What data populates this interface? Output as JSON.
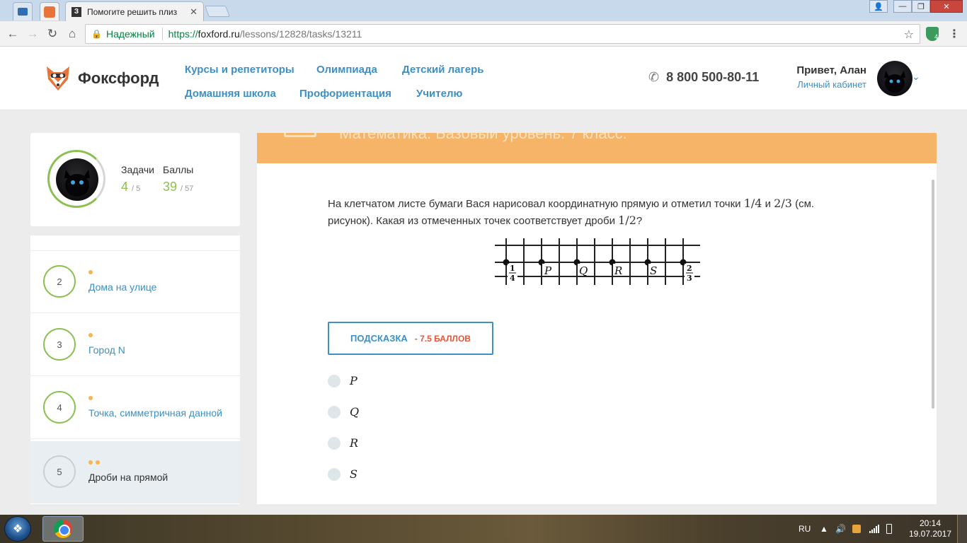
{
  "browser": {
    "tab_title": "Помогите решить плиз",
    "tab_favicon_letter": "З",
    "secure_label": "Надежный",
    "url_scheme": "https://",
    "url_host": "foxford.ru",
    "url_path": "/lessons/12828/tasks/13211",
    "extension_badge": "4"
  },
  "header": {
    "logo_text": "Фоксфорд",
    "nav": [
      "Курсы и репетиторы",
      "Олимпиада",
      "Детский лагерь",
      "Домашняя школа",
      "Профориентация",
      "Учителю"
    ],
    "phone": "8 800 500-80-11",
    "greeting": "Привет, Алан",
    "cabinet_link": "Личный кабинет"
  },
  "profile": {
    "tasks_label": "Задачи",
    "tasks_value": "4",
    "tasks_total": "/ 5",
    "points_label": "Баллы",
    "points_value": "39",
    "points_total": "/ 57"
  },
  "tasks": [
    {
      "num": "2",
      "title": "Дома на улице",
      "dots": 1
    },
    {
      "num": "3",
      "title": "Город N",
      "dots": 1
    },
    {
      "num": "4",
      "title": "Точка, симметричная данной",
      "dots": 1
    },
    {
      "num": "5",
      "title": "Дроби на прямой",
      "dots": 2,
      "active": true
    }
  ],
  "lesson": {
    "banner_title": "Математика. Базовый уровень. 7 класс.",
    "question_part1": "На клетчатом листе бумаги Вася нарисовал координатную прямую и отметил точки ",
    "frac_a": "1/4",
    "question_and": " и ",
    "frac_b": "2/3",
    "question_part2": " (см. рисунок). Какая из отмеченных точек соответствует дроби ",
    "frac_c": "1/2",
    "question_end": "?",
    "figure_labels": [
      "P",
      "Q",
      "R",
      "S"
    ],
    "figure_left_label_num": "1",
    "figure_left_label_den": "4",
    "figure_right_label_num": "2",
    "figure_right_label_den": "3",
    "hint_label": "ПОДСКАЗКА",
    "hint_penalty": "- 7.5 БАЛЛОВ",
    "options": [
      "P",
      "Q",
      "R",
      "S"
    ]
  },
  "taskbar": {
    "lang": "RU",
    "time": "20:14",
    "date": "19.07.2017"
  }
}
